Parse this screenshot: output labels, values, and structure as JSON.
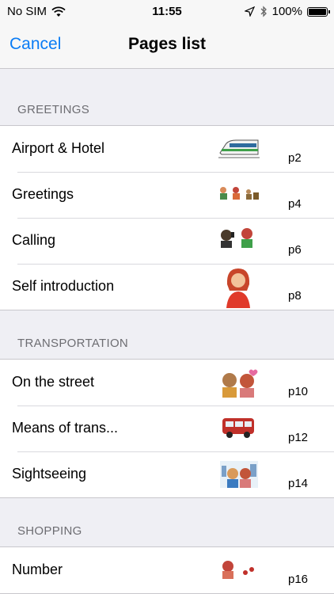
{
  "status": {
    "carrier": "No SIM",
    "time": "11:55",
    "battery": "100%"
  },
  "nav": {
    "cancel": "Cancel",
    "title": "Pages list"
  },
  "sections": [
    {
      "header": "GREETINGS",
      "rows": [
        {
          "label": "Airport & Hotel",
          "page": "p2",
          "icon": "train-icon"
        },
        {
          "label": "Greetings",
          "page": "p4",
          "icon": "greeting-people-icon"
        },
        {
          "label": "Calling",
          "page": "p6",
          "icon": "phone-call-icon"
        },
        {
          "label": "Self introduction",
          "page": "p8",
          "icon": "woman-icon"
        }
      ]
    },
    {
      "header": "TRANSPORTATION",
      "rows": [
        {
          "label": "On the street",
          "page": "p10",
          "icon": "couple-icon"
        },
        {
          "label": "Means of trans...",
          "page": "p12",
          "icon": "bus-icon"
        },
        {
          "label": "Sightseeing",
          "page": "p14",
          "icon": "sightseeing-icon"
        }
      ]
    },
    {
      "header": "SHOPPING",
      "rows": [
        {
          "label": "Number",
          "page": "p16",
          "icon": "shopping-icon"
        }
      ]
    }
  ]
}
